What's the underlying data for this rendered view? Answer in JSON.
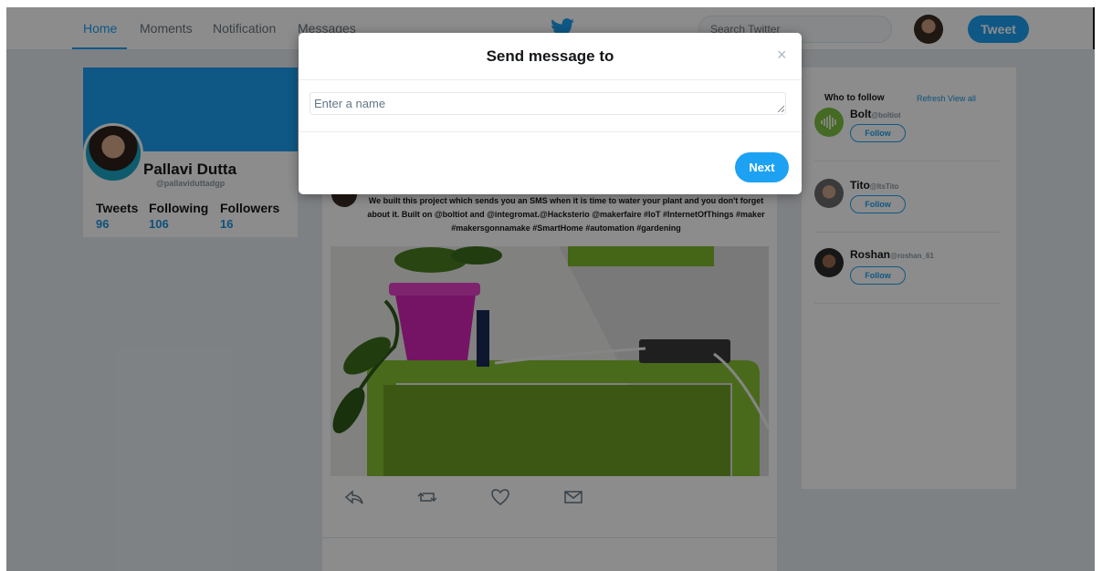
{
  "nav": {
    "home": "Home",
    "moments": "Moments",
    "notification": "Notification",
    "messages": "Messages",
    "search_placeholder": "Search Twitter",
    "tweet_button": "Tweet",
    "logo_icon": "twitter-bird-icon",
    "accent_color": "#1da1f2"
  },
  "profile": {
    "name": "Pallavi Dutta",
    "handle": "@pallaviduttadgp",
    "stats": [
      {
        "label": "Tweets",
        "value": "96"
      },
      {
        "label": "Following",
        "value": "106"
      },
      {
        "label": "Followers",
        "value": "16"
      }
    ]
  },
  "tweet": {
    "text": "We built this project which sends you an SMS when it is time to water your plant and you don't forget about it. Built on @boltiot and @integromat.@Hacksterio @makerfaire #IoT #InternetOfThings #maker #makersgonnamake #SmartHome #automation #gardening",
    "actions": [
      "reply-icon",
      "retweet-icon",
      "like-icon",
      "message-icon"
    ]
  },
  "who_to_follow": {
    "title": "Who to follow",
    "links": "Refresh View all",
    "follow_label": "Follow",
    "users": [
      {
        "name": "Bolt",
        "handle": "@boltiot"
      },
      {
        "name": "Tito",
        "handle": "@ItsTito"
      },
      {
        "name": "Roshan",
        "handle": "@roshan_61"
      }
    ]
  },
  "modal": {
    "title": "Send message to",
    "close": "×",
    "input_placeholder": "Enter a name",
    "next_button": "Next"
  }
}
